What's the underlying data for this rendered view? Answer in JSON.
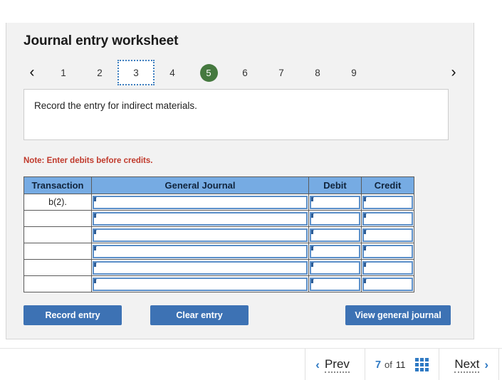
{
  "worksheet": {
    "title": "Journal entry worksheet",
    "prev_arrow": "‹",
    "next_arrow": "›",
    "steps": [
      {
        "label": "1",
        "state": "normal"
      },
      {
        "label": "2",
        "state": "normal"
      },
      {
        "label": "3",
        "state": "focused"
      },
      {
        "label": "4",
        "state": "normal"
      },
      {
        "label": "5",
        "state": "current"
      },
      {
        "label": "6",
        "state": "normal"
      },
      {
        "label": "7",
        "state": "normal"
      },
      {
        "label": "8",
        "state": "normal"
      },
      {
        "label": "9",
        "state": "normal"
      }
    ],
    "instruction": "Record the entry for indirect materials.",
    "note": "Note: Enter debits before credits."
  },
  "journal_table": {
    "headers": [
      "Transaction",
      "General Journal",
      "Debit",
      "Credit"
    ],
    "rows": [
      {
        "transaction": "b(2).",
        "general_journal": "",
        "debit": "",
        "credit": ""
      },
      {
        "transaction": "",
        "general_journal": "",
        "debit": "",
        "credit": ""
      },
      {
        "transaction": "",
        "general_journal": "",
        "debit": "",
        "credit": ""
      },
      {
        "transaction": "",
        "general_journal": "",
        "debit": "",
        "credit": ""
      },
      {
        "transaction": "",
        "general_journal": "",
        "debit": "",
        "credit": ""
      },
      {
        "transaction": "",
        "general_journal": "",
        "debit": "",
        "credit": ""
      }
    ]
  },
  "actions": {
    "record_entry": "Record entry",
    "clear_entry": "Clear entry",
    "view_general_journal": "View general journal"
  },
  "bottom_nav": {
    "prev_chevron": "‹",
    "prev_label": "Prev",
    "current_page": "7",
    "of_label": "of",
    "total_pages": "11",
    "grid_icon": "grid-icon",
    "next_label": "Next",
    "next_chevron": "›"
  },
  "colors": {
    "button_blue": "#3d72b4",
    "table_header_blue": "#76abe3",
    "current_step_green": "#45793f",
    "note_red": "#c0392b",
    "link_blue": "#2f7ac4",
    "card_bg": "#f2f2f2"
  }
}
